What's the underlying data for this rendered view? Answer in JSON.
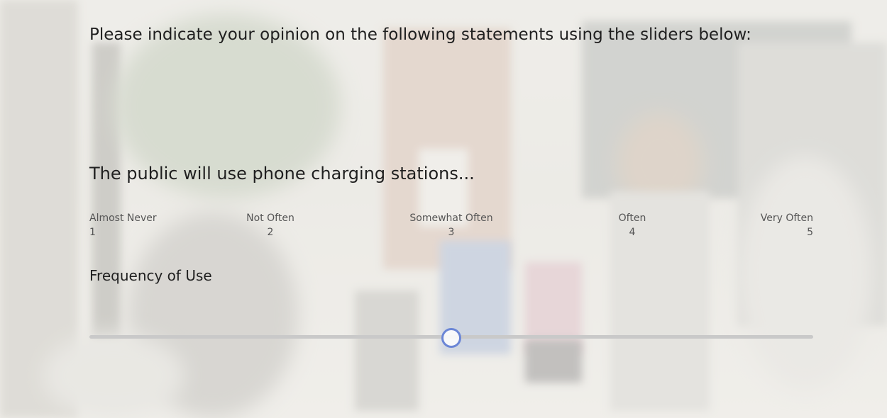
{
  "survey": {
    "prompt": "Please indicate your opinion on the following statements using the sliders below:",
    "statement": "The public will use phone charging stations...",
    "slider": {
      "label": "Frequency of Use",
      "min": 1,
      "max": 5,
      "value": 3,
      "ticks": [
        {
          "label": "Almost Never",
          "num": "1"
        },
        {
          "label": "Not Often",
          "num": "2"
        },
        {
          "label": "Somewhat Often",
          "num": "3"
        },
        {
          "label": "Often",
          "num": "4"
        },
        {
          "label": "Very Often",
          "num": "5"
        }
      ]
    }
  },
  "colors": {
    "thumb_border": "#6b86d6",
    "track": "#c9c9c9"
  }
}
